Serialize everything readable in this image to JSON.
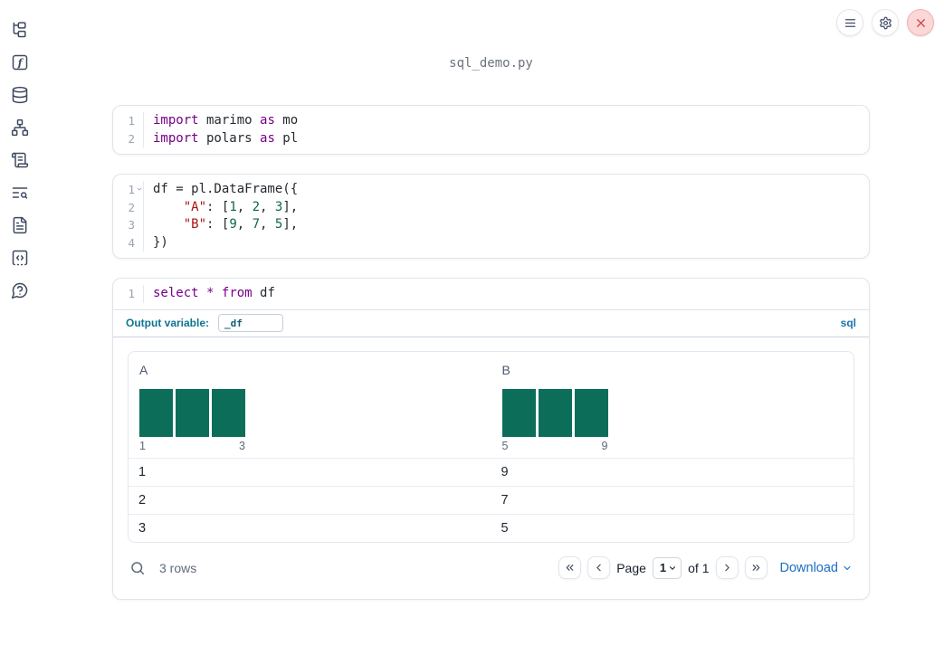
{
  "app": {
    "title": "sql_demo.py"
  },
  "colors": {
    "keyword": "#770088",
    "string": "#aa1111",
    "number": "#116644",
    "histogram_bar": "#0c6e58",
    "accent_teal": "#0e7490",
    "link_blue": "#1b6ec2",
    "close_red": "#d23d3d"
  },
  "sidebar": {
    "items": [
      {
        "icon": "file-explorer-icon"
      },
      {
        "icon": "variables-icon"
      },
      {
        "icon": "data-sources-icon"
      },
      {
        "icon": "dependency-graph-icon"
      },
      {
        "icon": "logs-icon"
      },
      {
        "icon": "text-search-icon"
      },
      {
        "icon": "documentation-icon"
      },
      {
        "icon": "snippets-icon"
      },
      {
        "icon": "help-icon"
      }
    ]
  },
  "topbar": {
    "icons": [
      "menu-icon",
      "gear-icon",
      "close-icon"
    ]
  },
  "cells": [
    {
      "type": "python",
      "lines": [
        {
          "num": "1",
          "fold": false,
          "tokens": [
            [
              "import",
              "kw"
            ],
            [
              " marimo ",
              "pl"
            ],
            [
              "as",
              "kw"
            ],
            [
              " mo",
              "pl"
            ]
          ]
        },
        {
          "num": "2",
          "fold": false,
          "tokens": [
            [
              "import",
              "kw"
            ],
            [
              " polars ",
              "pl"
            ],
            [
              "as",
              "kw"
            ],
            [
              " pl",
              "pl"
            ]
          ]
        }
      ]
    },
    {
      "type": "python",
      "lines": [
        {
          "num": "1",
          "fold": true,
          "tokens": [
            [
              "df = pl.DataFrame({",
              "pl"
            ]
          ]
        },
        {
          "num": "2",
          "fold": false,
          "tokens": [
            [
              "    ",
              "pl"
            ],
            [
              "\"A\"",
              "str"
            ],
            [
              ": [",
              "pl"
            ],
            [
              "1",
              "num"
            ],
            [
              ", ",
              "pl"
            ],
            [
              "2",
              "num"
            ],
            [
              ", ",
              "pl"
            ],
            [
              "3",
              "num"
            ],
            [
              "],",
              "pl"
            ]
          ]
        },
        {
          "num": "3",
          "fold": false,
          "tokens": [
            [
              "    ",
              "pl"
            ],
            [
              "\"B\"",
              "str"
            ],
            [
              ": [",
              "pl"
            ],
            [
              "9",
              "num"
            ],
            [
              ", ",
              "pl"
            ],
            [
              "7",
              "num"
            ],
            [
              ", ",
              "pl"
            ],
            [
              "5",
              "num"
            ],
            [
              "],",
              "pl"
            ]
          ]
        },
        {
          "num": "4",
          "fold": false,
          "tokens": [
            [
              "})",
              "pl"
            ]
          ]
        }
      ]
    },
    {
      "type": "sql",
      "lines": [
        {
          "num": "1",
          "fold": false,
          "tokens": [
            [
              "select",
              "kw"
            ],
            [
              " ",
              "pl"
            ],
            [
              "*",
              "kw"
            ],
            [
              " ",
              "pl"
            ],
            [
              "from",
              "kw"
            ],
            [
              " df",
              "pl"
            ]
          ]
        }
      ]
    }
  ],
  "sql_cell": {
    "output_variable_label": "Output variable:",
    "output_variable_value": "_df",
    "language_label": "sql"
  },
  "table": {
    "columns": [
      {
        "name": "A",
        "histogram": {
          "bars": [
            1,
            1,
            1
          ],
          "min_label": "1",
          "max_label": "3"
        }
      },
      {
        "name": "B",
        "histogram": {
          "bars": [
            1,
            1,
            1
          ],
          "min_label": "5",
          "max_label": "9"
        }
      }
    ],
    "rows": [
      [
        "1",
        "9"
      ],
      [
        "2",
        "7"
      ],
      [
        "3",
        "5"
      ]
    ],
    "footer": {
      "row_count": "3 rows",
      "page_label": "Page",
      "page_value": "1",
      "of_label": "of 1",
      "download_label": "Download"
    }
  }
}
